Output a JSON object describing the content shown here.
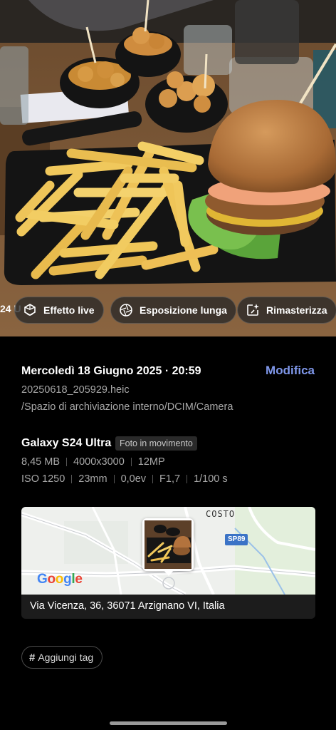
{
  "photo": {
    "chip_cut_text": "24 U",
    "chips": [
      {
        "label": "Effetto live",
        "icon": "live-effect-icon"
      },
      {
        "label": "Esposizione lunga",
        "icon": "long-exposure-icon"
      },
      {
        "label": "Rimasterizza",
        "icon": "remaster-icon"
      }
    ]
  },
  "details": {
    "datetime": "Mercoledì 18 Giugno 2025 · 20:59",
    "edit_label": "Modifica",
    "filename": "20250618_205929.heic",
    "path": "/Spazio di archiviazione interno/DCIM/Camera",
    "device": "Galaxy S24 Ultra",
    "motion_badge": "Foto in movimento",
    "size": "8,45 MB",
    "resolution": "4000x3000",
    "megapixels": "12MP",
    "iso": "ISO 1250",
    "focal": "23mm",
    "exposure_value": "0,0ev",
    "aperture": "F1,7",
    "shutter": "1/100 s"
  },
  "map": {
    "town_label": "COSTO",
    "road_label": "SP89",
    "logo_text": "Google",
    "address": "Via Vicenza, 36, 36071 Arzignano VI, Italia"
  },
  "tags": {
    "add_label": "Aggiungi tag"
  },
  "colors": {
    "accent": "#7f97ea",
    "background": "#000000",
    "secondary_text": "#a8a8a8"
  }
}
